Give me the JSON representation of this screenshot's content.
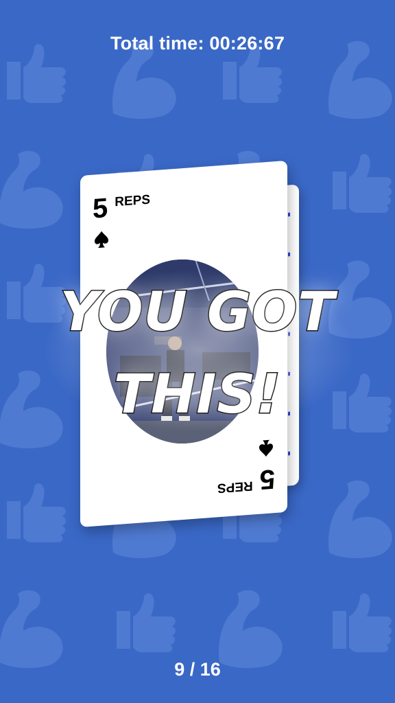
{
  "header": {
    "total_time_label": "Total time: 00:26:67"
  },
  "card": {
    "rank": "5",
    "reps_label": "REPS",
    "suit": "spade-icon"
  },
  "motivation": {
    "line1": "YOU GOT",
    "line2": "THIS!"
  },
  "progress": {
    "label": "9 / 16",
    "current": 9,
    "total": 16
  },
  "colors": {
    "background": "#3a68c6",
    "pattern": "#4f7ad1",
    "card": "#ffffff",
    "card_edge_accent": "#2b3fd6"
  },
  "background_pattern": [
    "flexed-biceps-icon",
    "thumbs-up-icon"
  ]
}
